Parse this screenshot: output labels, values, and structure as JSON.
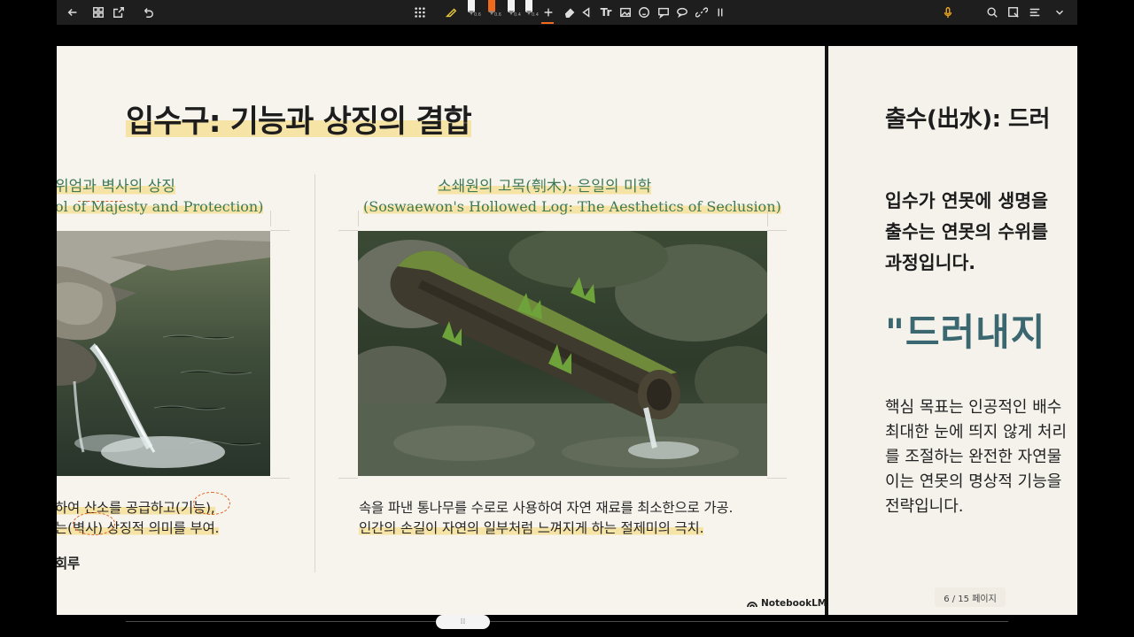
{
  "toolbar": {
    "left_icons": [
      "back-arrow-icon",
      "grid-view-icon",
      "export-icon",
      "undo-icon"
    ],
    "center_icons": [
      "apps-grid-icon",
      "highlighter-icon",
      "pen-icon",
      "pen-icon",
      "pen-icon",
      "pen-icon",
      "add-icon",
      "eraser-icon",
      "lasso-icon",
      "text-icon",
      "image-icon",
      "sticker-icon",
      "comment-icon",
      "chat-icon",
      "link-icon",
      "more-icon"
    ],
    "pen_sizes": [
      "0.6",
      "0.6",
      "0.4",
      "0.4"
    ],
    "accent_color": "#f26b1d",
    "right_icons": [
      "microphone-icon",
      "search-icon",
      "crop-icon",
      "list-icon",
      "chevron-down-icon"
    ]
  },
  "slide": {
    "title": "입수구: 기능과 상징의 결합",
    "left": {
      "subtitle_ko": "위엄과 벽사의 상징",
      "subtitle_en": "ol of Majesty and Protection)",
      "body_line1": "하여 산소를 공급하고(기능),",
      "body_line2": "는(벽사) 상징적 의미를 부여.",
      "caption": "회루"
    },
    "right": {
      "subtitle_ko": "소쇄원의 고목(刳木): 은일의 미학",
      "subtitle_en": "(Soswaewon's Hollowed Log: The Aesthetics of Seclusion)",
      "body_line1": "속을 파낸 통나무를 수로로 사용하여 자연 재료를 최소한으로 가공.",
      "body_line2": "인간의 손길이 자연의 일부처럼 느껴지게 하는 절제미의 극치."
    },
    "brand": "NotebookLM"
  },
  "next_slide": {
    "title": "출수(出水): 드러",
    "lead_line1": "입수가 연못에 생명을",
    "lead_line2": "출수는 연못의 수위를",
    "lead_line3": "과정입니다.",
    "quote": "\"드러내지",
    "body_line1": "핵심 목표는 인공적인 배수",
    "body_line2": "최대한 눈에 띄지 않게 처리",
    "body_line3": "를 조절하는 완전한 자연물",
    "body_line4": "이는 연못의 명상적 기능을",
    "body_line5": "전략입니다."
  },
  "page_indicator": "6 / 15 페이지",
  "scroll_handle": "⁞⁞"
}
